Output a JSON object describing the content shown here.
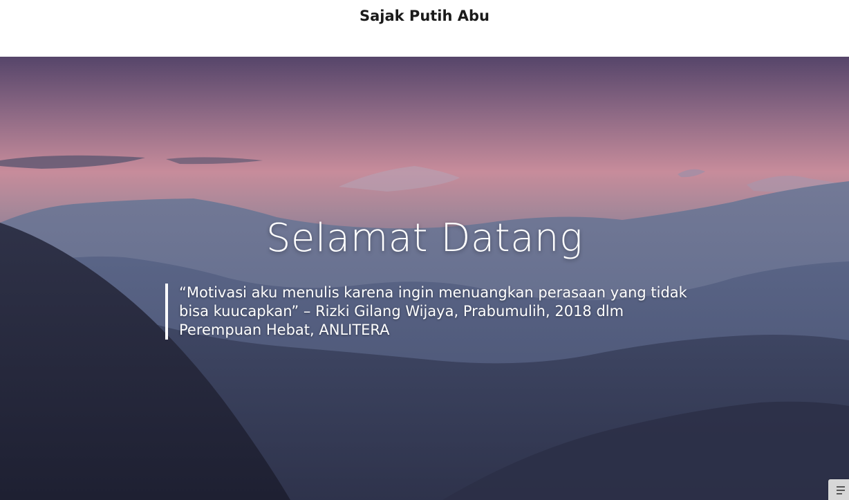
{
  "header": {
    "site_title": "Sajak Putih Abu"
  },
  "hero": {
    "title": "Selamat Datang",
    "quote": "“Motivasi aku menulis karena ingin menuangkan perasaan yang tidak bisa kuucapkan” – Rizki Gilang Wijaya, Prabumulih, 2018 dlm Perempuan Hebat, ANLITERA",
    "background_icon": "mountain-landscape-image"
  },
  "widget": {
    "icon": "notes-icon"
  },
  "colors": {
    "header_bg": "#ffffff",
    "title_text": "#1a1a1a",
    "hero_text": "#ffffff",
    "sky_pink": "#c48a9a",
    "mountain_blue": "#454f6c"
  }
}
